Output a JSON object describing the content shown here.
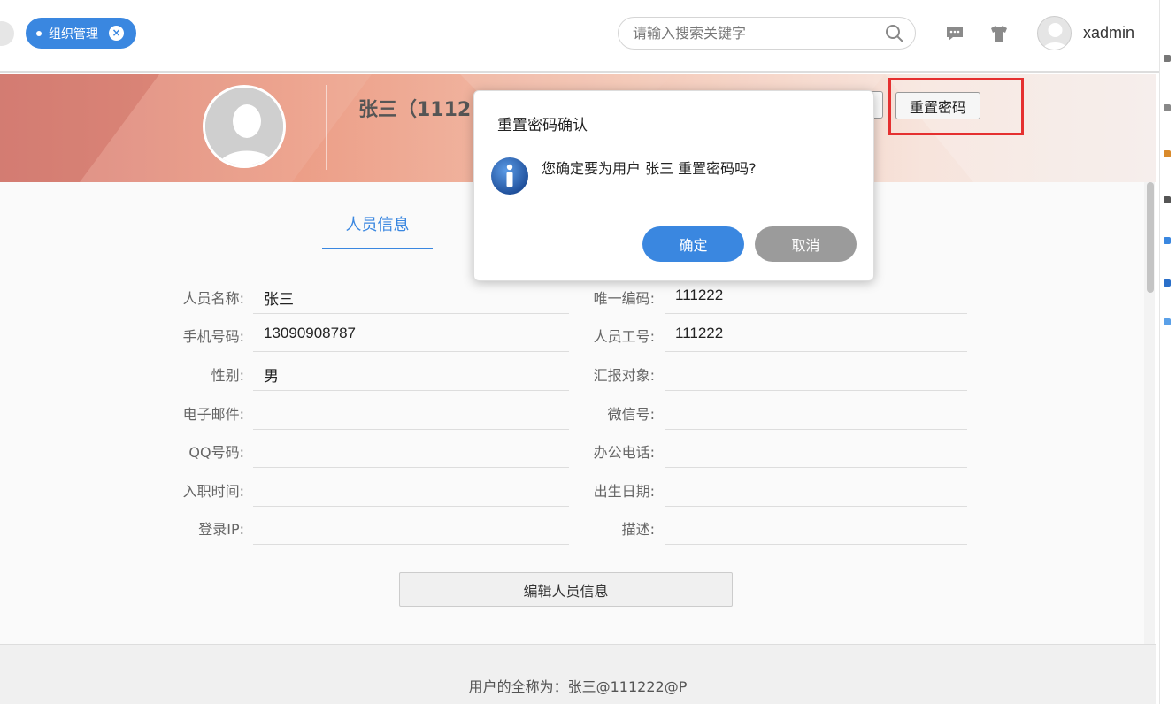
{
  "header": {
    "tab_label": "组织管理",
    "search_placeholder": "请输入搜索关键字",
    "username": "xadmin"
  },
  "banner": {
    "name_partial": "张三（11122",
    "reset_button_label": "重置密码"
  },
  "tabs": [
    {
      "label": "人员信息",
      "active": true
    }
  ],
  "fields_left": [
    {
      "label": "人员名称:",
      "value": "张三"
    },
    {
      "label": "手机号码:",
      "value": "13090908787"
    },
    {
      "label": "性别:",
      "value": "男"
    },
    {
      "label": "电子邮件:",
      "value": ""
    },
    {
      "label": "QQ号码:",
      "value": ""
    },
    {
      "label": "入职时间:",
      "value": ""
    },
    {
      "label": "登录IP:",
      "value": ""
    }
  ],
  "fields_right": [
    {
      "label": "唯一编码:",
      "value": "111222"
    },
    {
      "label": "人员工号:",
      "value": "111222"
    },
    {
      "label": "汇报对象:",
      "value": ""
    },
    {
      "label": "微信号:",
      "value": ""
    },
    {
      "label": "办公电话:",
      "value": ""
    },
    {
      "label": "出生日期:",
      "value": ""
    },
    {
      "label": "描述:",
      "value": ""
    }
  ],
  "edit_button_label": "编辑人员信息",
  "footer_text": "用户的全称为：张三@111222@P",
  "dialog": {
    "title": "重置密码确认",
    "message": "您确定要为用户 张三 重置密码吗?",
    "confirm_label": "确定",
    "cancel_label": "取消"
  },
  "colors": {
    "accent": "#3a87e0",
    "highlight_box": "#e53030",
    "cancel": "#9b9b9b"
  }
}
